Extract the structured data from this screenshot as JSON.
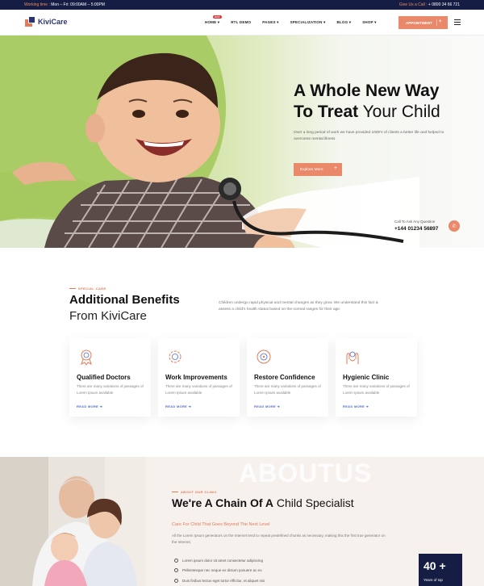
{
  "topbar": {
    "working_label": "Working time :",
    "working_hours": "Mon – Fri: 09:00AM – 5:00PM",
    "call_label": "Give Us a Call :",
    "call_number": "+ 0800 34 66 721"
  },
  "header": {
    "logo_text": "KiviCare",
    "nav": [
      {
        "label": "HOME ▾",
        "badge": "HOT"
      },
      {
        "label": "RTL DEMO"
      },
      {
        "label": "PAGES ▾"
      },
      {
        "label": "SPECIALIZATION ▾"
      },
      {
        "label": "BLOG ▾"
      },
      {
        "label": "SHOP ▾"
      }
    ],
    "appointment_label": "APPOINTMENT",
    "appointment_icon": "plus-icon",
    "menu_icon": "hamburger-icon"
  },
  "hero": {
    "title_bold_1": "A Whole New Way",
    "title_bold_2": "To Treat",
    "title_light_2": " Your Child",
    "description": "Over a long period of work we have provided 1000's of clients a better life and helped to overcome mental illness",
    "cta_label": "Explore More",
    "call_label": "Call To Ask Any Question",
    "call_number": "+144 01234 56897",
    "call_icon": "phone-icon"
  },
  "benefits": {
    "kicker": "SPECIAL CARE",
    "title": "Additional Benefits",
    "subtitle": "From KiviCare",
    "description": "Children undergo rapid physical and mental changes as they grow. We understand this fact & assess a child's health status based on the normal ranges for their age.",
    "cards": [
      {
        "icon": "doctor-badge-icon",
        "title": "Qualified Doctors",
        "text": "There are many variations of passages of Lorem Ipsum available",
        "link": "READ MORE ➜"
      },
      {
        "icon": "gear-improvement-icon",
        "title": "Work Improvements",
        "text": "There are many variations of passages of Lorem Ipsum available",
        "link": "READ MORE ➜"
      },
      {
        "icon": "confidence-target-icon",
        "title": "Restore Confidence",
        "text": "There are many variations of passages of Lorem Ipsum available",
        "link": "READ MORE ➜"
      },
      {
        "icon": "hygienic-hands-icon",
        "title": "Hygienic Clinic",
        "text": "There are many variations of passages of Lorem Ipsum available",
        "link": "READ MORE ➜"
      }
    ]
  },
  "about": {
    "watermark": "ABOUTUS",
    "kicker": "ABOUT OUR CLINIC",
    "title_bold": "We're A Chain Of A",
    "title_light": " Child Specialist",
    "subtitle": "Care For Child That Goes Beyond The Next Level",
    "description": "All the Lorem Ipsum generators on the Internet tend to repeat predefined chunks as necessary, making this the first true generator on the Internet.",
    "bullets": [
      "Lorem ipsum dolor sit amet consectetur adipiscing",
      "Pellentesque nec neque ex dictum posuere ac eu",
      "Duis finibus lectus eget tortor efficitur, et aliquet nisi"
    ],
    "years_number": "40 +",
    "years_label": "Years of top"
  },
  "colors": {
    "navy": "#151d44",
    "accent": "#e9896a",
    "link": "#4c6bd1"
  }
}
